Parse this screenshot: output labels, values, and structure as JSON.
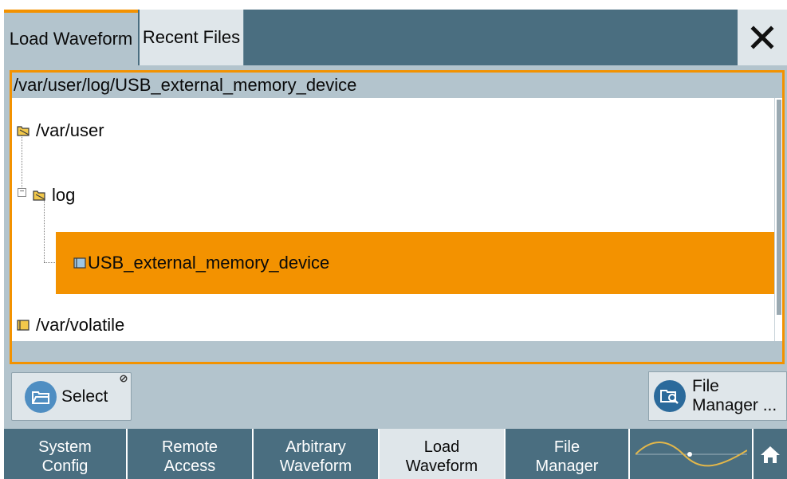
{
  "header": {
    "tabs": [
      {
        "label": "Load Waveform",
        "active": true
      },
      {
        "label": "Recent Files",
        "active": false
      }
    ],
    "close_icon": "close-icon"
  },
  "browser": {
    "current_path": "/var/user/log/USB_external_memory_device",
    "nodes": [
      {
        "label": "/var/user",
        "icon": "folder-open-icon"
      },
      {
        "label": "log",
        "icon": "folder-open-icon"
      },
      {
        "label": "USB_external_memory_device",
        "icon": "folder-icon",
        "selected": true
      },
      {
        "label": "/var/volatile",
        "icon": "folder-icon"
      }
    ]
  },
  "actions": {
    "select_label": "Select",
    "file_manager_line1": "File",
    "file_manager_line2": "Manager ..."
  },
  "taskbar": {
    "items": [
      {
        "line1": "System",
        "line2": "Config"
      },
      {
        "line1": "Remote",
        "line2": "Access"
      },
      {
        "line1": "Arbitrary",
        "line2": "Waveform"
      },
      {
        "line1": "Load",
        "line2": "Waveform",
        "active": true
      },
      {
        "line1": "File",
        "line2": "Manager"
      }
    ],
    "signal_icon": "sine-wave-icon",
    "home_icon": "home-icon"
  },
  "colors": {
    "accent": "#f39200",
    "titlebar": "#4a6e80",
    "panel": "#b3c4cd"
  }
}
